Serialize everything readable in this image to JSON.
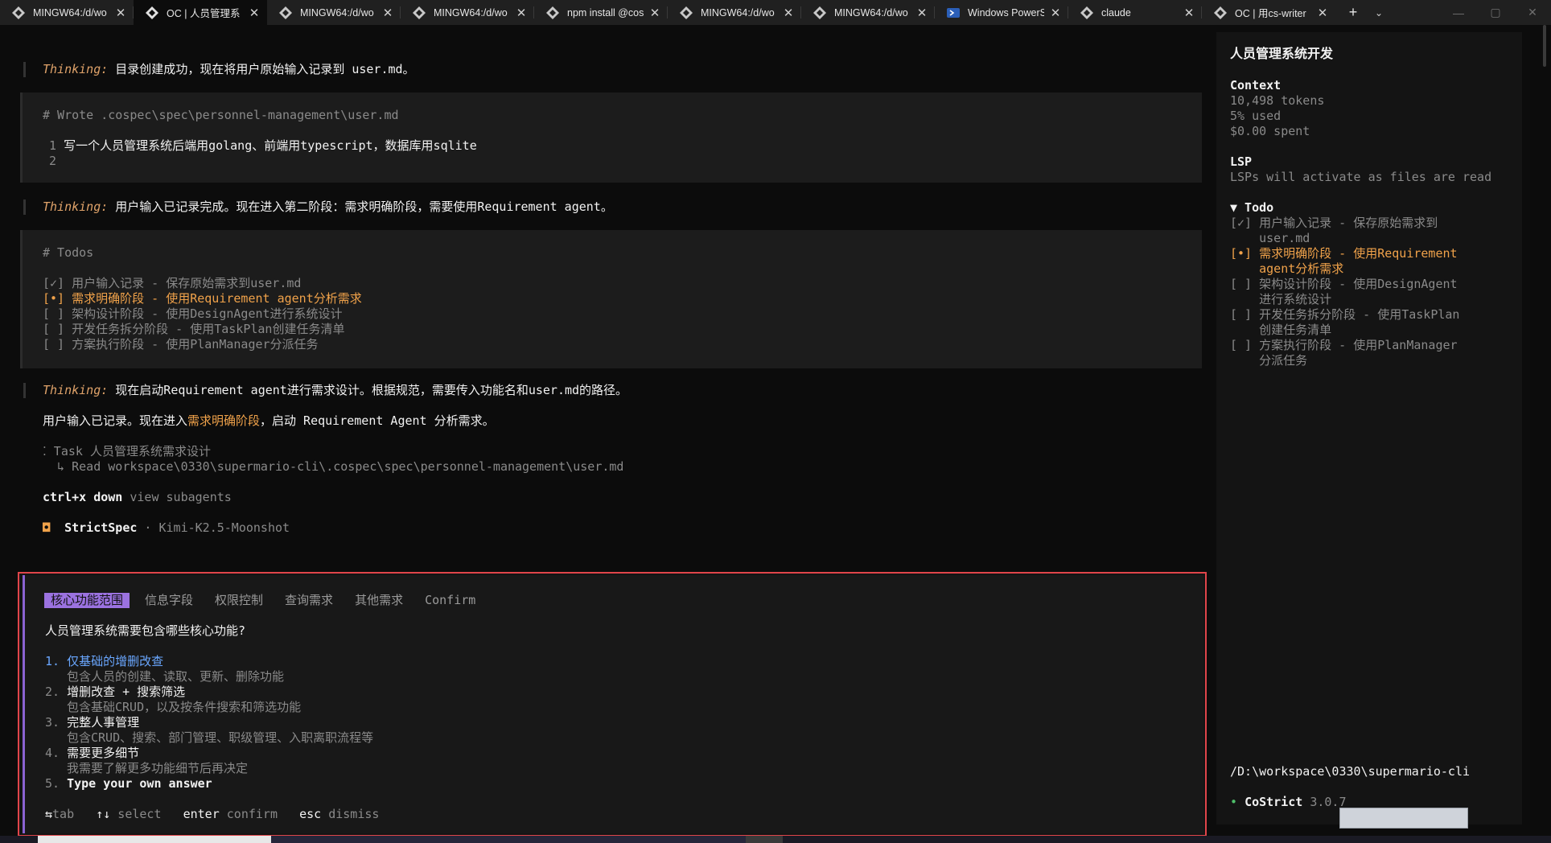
{
  "tabs": [
    {
      "title": "MINGW64:/d/wo",
      "icon": "git-bash-icon"
    },
    {
      "title": "OC | 人员管理系",
      "icon": "git-bash-icon",
      "active": true
    },
    {
      "title": "MINGW64:/d/wo",
      "icon": "git-bash-icon"
    },
    {
      "title": "MINGW64:/d/wo",
      "icon": "git-bash-icon"
    },
    {
      "title": "npm install @cos",
      "icon": "git-bash-icon"
    },
    {
      "title": "MINGW64:/d/wo",
      "icon": "git-bash-icon"
    },
    {
      "title": "MINGW64:/d/wo",
      "icon": "git-bash-icon"
    },
    {
      "title": "Windows PowerS",
      "icon": "powershell-icon"
    },
    {
      "title": "claude",
      "icon": "git-bash-icon"
    },
    {
      "title": "OC | 用cs-writer",
      "icon": "git-bash-icon"
    }
  ],
  "tab_actions": {
    "new_tab": "+",
    "dropdown": "⌄"
  },
  "window_controls": {
    "minimize": "—",
    "maximize": "▢",
    "close": "✕"
  },
  "colors": {
    "thinking": "#e0a36a",
    "in_progress": "#f0a24a",
    "accent_purple": "#9b72e0",
    "selected_option": "#6aa7ff",
    "question_border": "#e0454a"
  },
  "main": {
    "thinking_label": "Thinking:",
    "thinking1": " 目录创建成功，现在将用户原始输入记录到 user.md。",
    "wrote_header": "# Wrote .cospec\\spec\\personnel-management\\user.md",
    "file_lines": [
      {
        "num": "1",
        "text": "写一个人员管理系统后端用golang、前端用typescript，数据库用sqlite"
      },
      {
        "num": "2",
        "text": ""
      }
    ],
    "thinking2": " 用户输入已记录完成。现在进入第二阶段：需求明确阶段，需要使用Requirement agent。",
    "todos_header": "# Todos",
    "todos": [
      {
        "text": "[✓] 用户输入记录 - 保存原始需求到user.md",
        "state": "done"
      },
      {
        "text": "[•] 需求明确阶段 - 使用Requirement agent分析需求",
        "state": "active"
      },
      {
        "text": "[ ] 架构设计阶段 - 使用DesignAgent进行系统设计",
        "state": "pending"
      },
      {
        "text": "[ ] 开发任务拆分阶段 - 使用TaskPlan创建任务清单",
        "state": "pending"
      },
      {
        "text": "[ ] 方案执行阶段 - 使用PlanManager分派任务",
        "state": "pending"
      }
    ],
    "thinking3": " 现在启动Requirement agent进行需求设计。根据规范，需要传入功能名和user.md的路径。",
    "status_prefix": "用户输入已记录。现在进入",
    "status_highlight": "需求明确阶段",
    "status_suffix": "，启动 Requirement Agent 分析需求。",
    "task_line": "⁚ Task 人员管理系统需求设计",
    "task_sub": "  ↳ Read workspace\\0330\\supermario-cli\\.cospec\\spec\\personnel-management\\user.md",
    "hint_keys": "ctrl+x down",
    "hint_text": " view subagents",
    "agent_bullet": "◘",
    "agent_name": "StrictSpec",
    "agent_model": " · Kimi-K2.5-Moonshot"
  },
  "question": {
    "tabs": [
      "核心功能范围",
      "信息字段",
      "权限控制",
      "查询需求",
      "其他需求",
      "Confirm"
    ],
    "prompt": "人员管理系统需要包含哪些核心功能?",
    "options": [
      {
        "num": "1.",
        "label": "仅基础的增删改查",
        "desc": "包含人员的创建、读取、更新、删除功能"
      },
      {
        "num": "2.",
        "label": "增删改查 + 搜索筛选",
        "desc": "包含基础CRUD，以及按条件搜索和筛选功能"
      },
      {
        "num": "3.",
        "label": "完整人事管理",
        "desc": "包含CRUD、搜索、部门管理、职级管理、入职离职流程等"
      },
      {
        "num": "4.",
        "label": "需要更多细节",
        "desc": "我需要了解更多功能细节后再决定"
      },
      {
        "num": "5.",
        "label": "Type your own answer",
        "desc": ""
      }
    ],
    "footer": [
      {
        "key": "⇆",
        "text": "tab"
      },
      {
        "key": "↑↓",
        "text": " select"
      },
      {
        "key": "enter",
        "text": " confirm"
      },
      {
        "key": "esc",
        "text": " dismiss"
      }
    ]
  },
  "sidebar": {
    "title": "人员管理系统开发",
    "context_label": "Context",
    "tokens": "10,498 tokens",
    "used": "5% used",
    "spent": "$0.00 spent",
    "lsp_label": "LSP",
    "lsp_text": "LSPs will activate as files are read",
    "todo_label": "▼ Todo",
    "todos": [
      {
        "line1": "[✓] 用户输入记录 - 保存原始需求到",
        "line2": "    user.md",
        "state": "done"
      },
      {
        "line1": "[•] 需求明确阶段 - 使用Requirement",
        "line2": "    agent分析需求",
        "state": "active"
      },
      {
        "line1": "[ ] 架构设计阶段 - 使用DesignAgent",
        "line2": "    进行系统设计",
        "state": "pending"
      },
      {
        "line1": "[ ] 开发任务拆分阶段 - 使用TaskPlan",
        "line2": "    创建任务清单",
        "state": "pending"
      },
      {
        "line1": "[ ] 方案执行阶段 - 使用PlanManager",
        "line2": "    分派任务",
        "state": "pending"
      }
    ],
    "path": "/D:\\workspace\\0330\\supermario-cli",
    "version_bullet": "•",
    "version_name": "CoStrict",
    "version_num": " 3.0.7"
  }
}
